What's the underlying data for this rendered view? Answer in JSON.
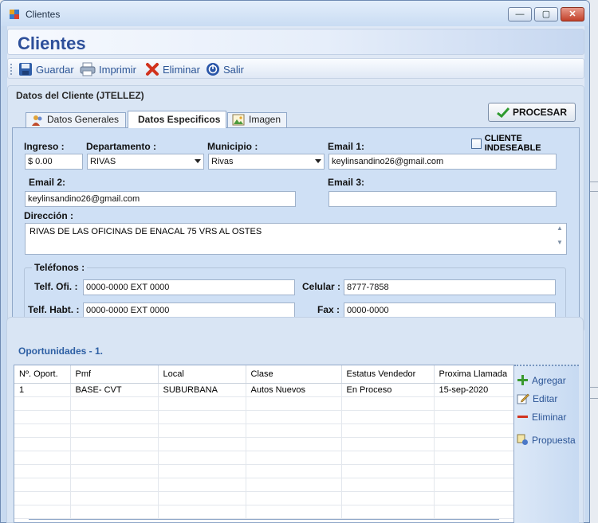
{
  "window": {
    "title": "Clientes"
  },
  "header": {
    "title": "Clientes"
  },
  "toolbar": {
    "save_label": "Guardar",
    "print_label": "Imprimir",
    "delete_label": "Eliminar",
    "exit_label": "Salir"
  },
  "client_section": {
    "title": "Datos del Cliente (JTELLEZ)"
  },
  "tabs": [
    {
      "label": "Datos Generales"
    },
    {
      "label": "Datos Especificos"
    },
    {
      "label": "Imagen"
    }
  ],
  "process_button": {
    "label": "PROCESAR"
  },
  "undesirable": {
    "label": "CLIENTE INDESEABLE"
  },
  "form": {
    "ingreso_label": "Ingreso :",
    "ingreso_value": "$ 0.00",
    "departamento_label": "Departamento :",
    "departamento_value": "RIVAS",
    "municipio_label": "Municipio :",
    "municipio_value": "Rivas",
    "email1_label": "Email 1:",
    "email1_value": "keylinsandino26@gmail.com",
    "email2_label": "Email 2:",
    "email2_value": "keylinsandino26@gmail.com",
    "email3_label": "Email 3:",
    "email3_value": "",
    "direccion_label": "Dirección :",
    "direccion_value": "RIVAS DE LAS OFICINAS DE ENACAL 75 VRS AL OSTES"
  },
  "phones": {
    "group_label": "Teléfonos :",
    "office_label": "Telf. Ofi. :",
    "office_value": "0000-0000 EXT 0000",
    "mobile_label": "Celular :",
    "mobile_value": "8777-7858",
    "home_label": "Telf. Habt. :",
    "home_value": "0000-0000 EXT 0000",
    "fax_label": "Fax :",
    "fax_value": "0000-0000"
  },
  "opportunities": {
    "title": "Oportunidades - 1.",
    "columns": [
      "Nº. Oport.",
      "Pmf",
      "Local",
      "Clase",
      "Estatus Vendedor",
      "Proxima Llamada"
    ],
    "rows": [
      [
        "1",
        "BASE- CVT",
        "SUBURBANA",
        "Autos Nuevos",
        "En Proceso",
        "15-sep-2020"
      ]
    ],
    "actions": {
      "add": "Agregar",
      "edit": "Editar",
      "delete": "Eliminar",
      "proposal": "Propuesta"
    }
  },
  "colors": {
    "accent": "#2d4f9a",
    "link": "#2c5596",
    "panel": "#d9e5f4",
    "tab_content": "#cfe0f5"
  }
}
